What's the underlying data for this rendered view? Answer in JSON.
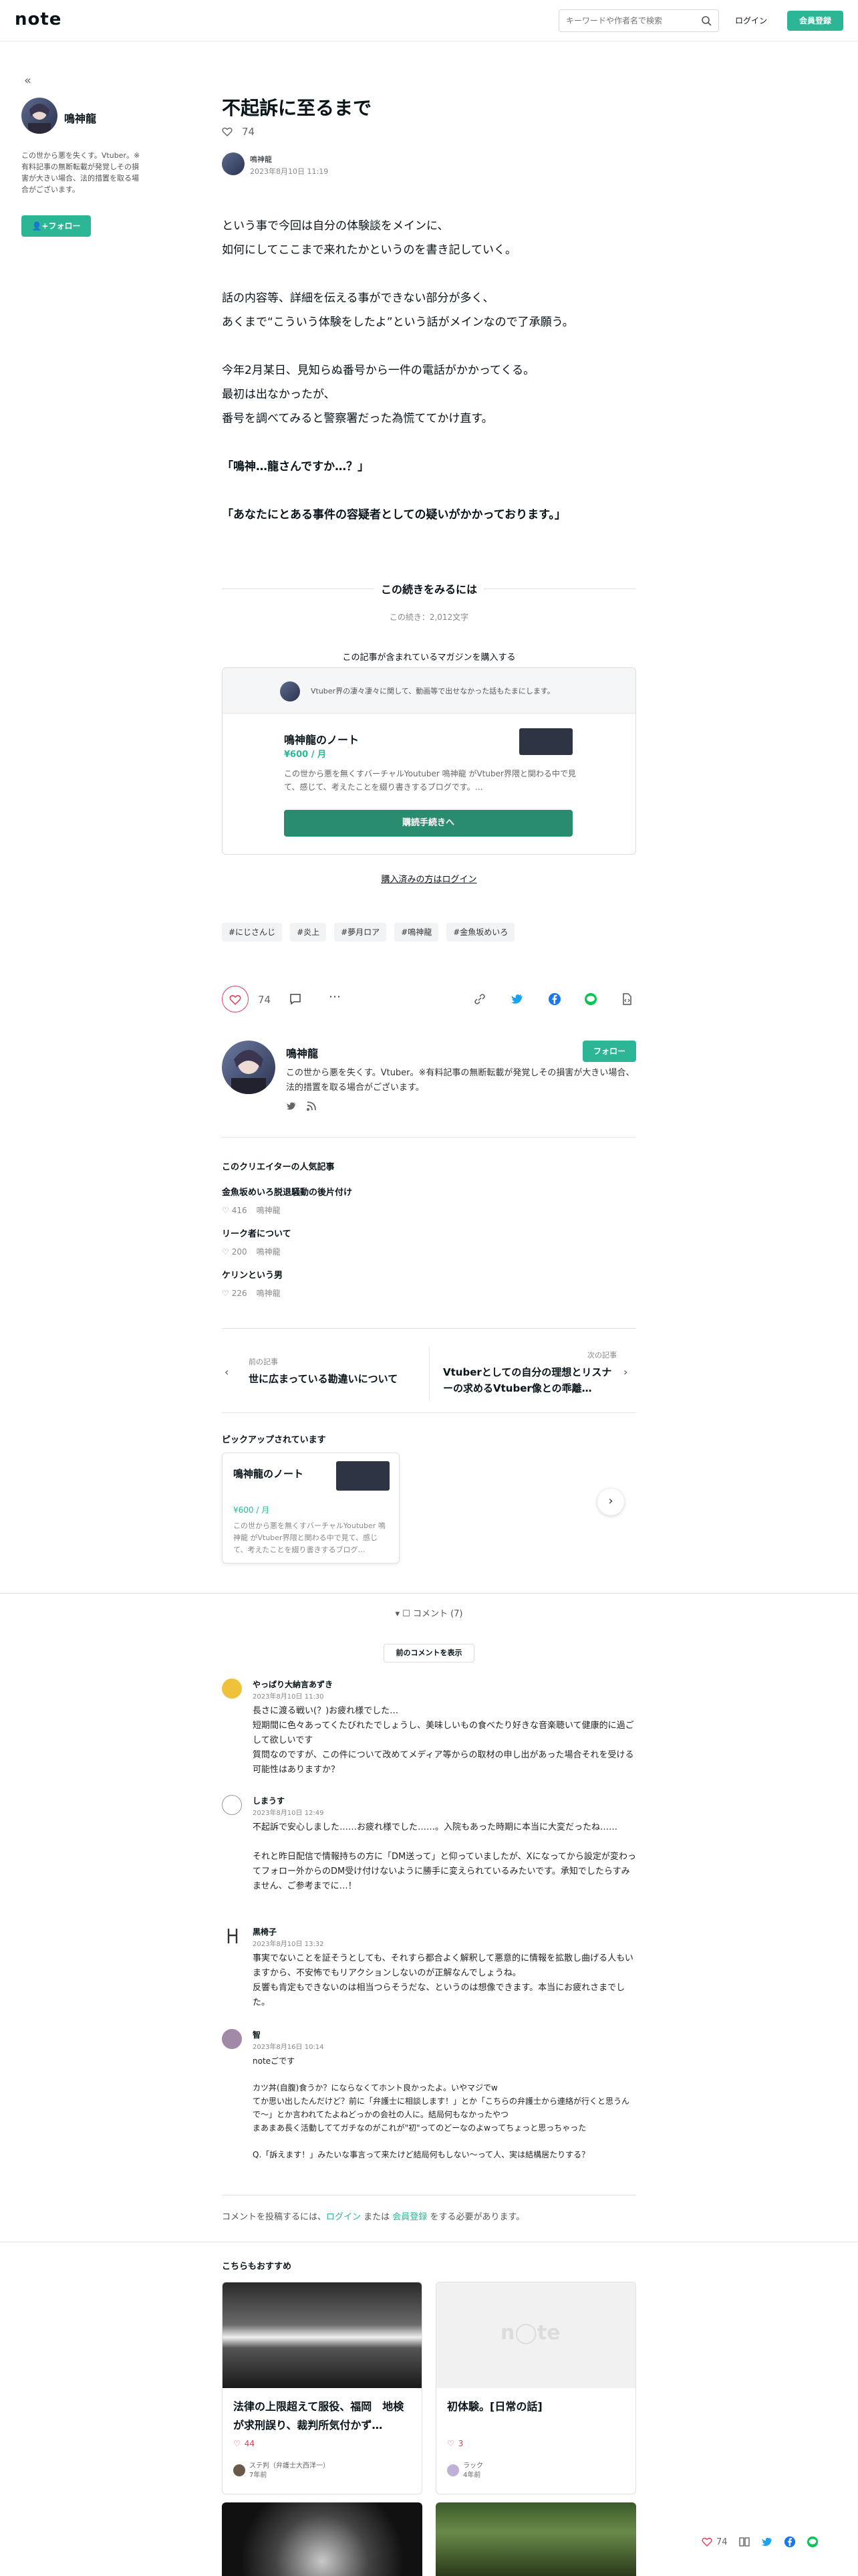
{
  "header": {
    "logo": "note",
    "search_placeholder": "キーワードや作者名で検索",
    "login": "ログイン",
    "signup": "会員登録"
  },
  "sidebar": {
    "author_name": "鳴神龍",
    "bio": "この世から悪を失くす。Vtuber。※有料記事の無断転載が発覚しその損害が大きい場合、法的措置を取る場合がございます。",
    "follow": "フォロー"
  },
  "article": {
    "title": "不起訴に至るまで",
    "likes": "74",
    "author": "鳴神龍",
    "date": "2023年8月10日 11:19",
    "body": [
      [
        "という事で今回は自分の体験談をメインに、",
        "如何にしてここまで来れたかというのを書き記していく。"
      ],
      [
        "話の内容等、詳細を伝える事ができない部分が多く、",
        "あくまで“こういう体験をしたよ”という話がメインなので了承願う。"
      ],
      [
        "今年2月某日、見知らぬ番号から一件の電話がかかってくる。",
        "最初は出なかったが、",
        "番号を調べてみると警察署だった為慌ててかけ直す。"
      ],
      [
        "「鳴神…龍さんですか…？」"
      ],
      [
        "「あなたにとある事件の容疑者としての疑いがかかっております。」"
      ]
    ]
  },
  "paywall": {
    "title": "この続きをみるには",
    "count": "この続き：2,012文字",
    "magazine_label": "この記事が含まれているマガジンを購入する",
    "magazine_header": "Vtuber界の凄々凄々に関して、動画等で出せなかった話もたまにします。",
    "magazine_name": "鳴神龍のノート",
    "magazine_price": "¥600 / 月",
    "magazine_desc": "この世から悪を無くすバーチャルYoutuber 鳴神龍 がVtuber界隈と関わる中で見て、感じて、考えたことを綴り書きするブログです。…",
    "buy_button": "購読手続きへ",
    "buyer_login": "購入済みの方はログイン"
  },
  "tags": [
    "#にじさんじ",
    "#炎上",
    "#夢月ロア",
    "#鳴神龍",
    "#金魚坂めいろ"
  ],
  "actions": {
    "likes": "74"
  },
  "author_card": {
    "name": "鳴神龍",
    "follow": "フォロー",
    "bio": "この世から悪を失くす。Vtuber。※有料記事の無断転載が発覚しその損害が大きい場合、法的措置を取る場合がございます。"
  },
  "popular": {
    "title": "このクリエイターの人気記事",
    "items": [
      {
        "title": "金魚坂めいろ脱退騒動の後片付け",
        "likes": "416",
        "author": "鳴神龍"
      },
      {
        "title": "リーク者について",
        "likes": "200",
        "author": "鳴神龍"
      },
      {
        "title": "ケリンという男",
        "likes": "226",
        "author": "鳴神龍"
      }
    ]
  },
  "prevnext": {
    "prev_label": "前の記事",
    "prev_title": "世に広まっている勘違いについて",
    "next_label": "次の記事",
    "next_title": "Vtuberとしての自分の理想とリスナーの求めるVtuber像との乖離…"
  },
  "pickup": {
    "title": "ピックアップされています",
    "name": "鳴神龍のノート",
    "price": "¥600 / 月",
    "desc": "この世から悪を無くすバーチャルYoutuber 鳴神龍 がVtuber界隈と関わる中で見て、感じて、考えたことを綴り書きするブログ…"
  },
  "comments": {
    "header": "コメント (7)",
    "prev_button": "前のコメントを表示",
    "items": [
      {
        "name": "やっぱり大納言あずき",
        "date": "2023年8月10日 11:30",
        "body": [
          "長さに渡る戦い(？)お疲れ様でした…",
          "短期間に色々あってくたびれたでしょうし、美味しいもの食べたり好きな音楽聴いて健康的に過ごして欲しいです",
          "質問なのですが、この件について改めてメディア等からの取材の申し出があった場合それを受ける可能性はありますか？"
        ]
      },
      {
        "name": "しまうす",
        "date": "2023年8月10日 12:49",
        "body": [
          "不起訴で安心しました……お疲れ様でした……。入院もあった時期に本当に大変だったね……",
          "",
          "それと昨日配信で情報持ちの方に「DM送って」と仰っていましたが、Xになってから設定が変わってフォロー外からのDM受け付けないように勝手に変えられているみたいです。承知でしたらすみません、ご参考までに…！"
        ]
      },
      {
        "name": "黒椅子",
        "date": "2023年8月10日 13:32",
        "body": [
          "事実でないことを証そうとしても、それすら都合よく解釈して悪意的に情報を拡散し曲げる人もいますから、不安怖でもリアクションしないのが正解なんでしょうね。",
          "反響も肯定もできないのは相当つらそうだな、というのは想像できます。本当にお疲れさまでした。"
        ]
      },
      {
        "name": "智",
        "date": "2023年8月16日 10:14",
        "body": [
          "noteごです",
          "",
          "カツ丼(自腹)食うか？にならなくてホント良かったよ。いやマジでw",
          "てか思い出したんだけど？前に「弁護士に相談します！」とか「こちらの弁護士から連絡が行くと思うんで〜」とか言われてたよねどっかの会社の人に。結局何もなかったやつ",
          "まあまあ長く活動しててガチなのがこれが\"初\"ってのどーなのよwってちょっと思っちゃった",
          "",
          "Q.「訴えます！」みたいな事言って来たけど結局何もしない〜って人、実は結構居たりする？"
        ]
      }
    ],
    "login_prompt_pre": "コメントを投稿するには、",
    "login_link": "ログイン",
    "login_mid": " または ",
    "signup_link": "会員登録",
    "login_prompt_post": " をする必要があります。"
  },
  "recommend": {
    "title": "こちらもおすすめ",
    "items": [
      {
        "title": "法律の上限超えて服役、福岡　地検が求刑誤り、裁判所気付かず…",
        "likes": "44",
        "author": "ステ判（弁護士大西洋一）",
        "age": "7年前"
      },
      {
        "title": "初体験。[日常の話]",
        "likes": "3",
        "author": "ラック",
        "age": "4年前"
      }
    ]
  },
  "floating": {
    "likes": "74"
  },
  "colors": {
    "accent": "#2cb696",
    "like": "#e04058"
  }
}
